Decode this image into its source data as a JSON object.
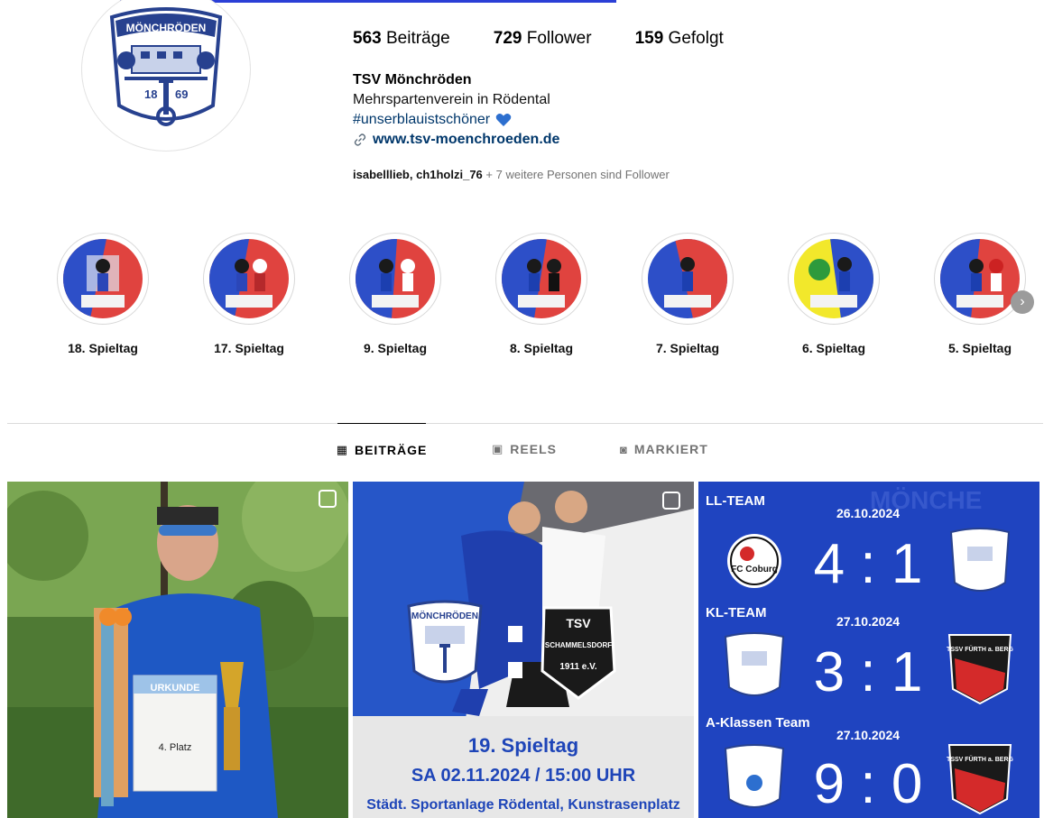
{
  "profile": {
    "posts_count": "563",
    "posts_label": "Beiträge",
    "followers_count": "729",
    "followers_label": "Follower",
    "following_count": "159",
    "following_label": "Gefolgt",
    "name": "TSV Mönchröden",
    "bio_line": "Mehrspartenverein in Rödental",
    "hashtag": "#unserblauistschöner",
    "website": "www.tsv-moenchroeden.de",
    "followed_by_names": "isabelllieb, ch1holzi_76",
    "followed_by_more": "+ 7 weitere Personen sind Follower",
    "logo_text": "MÖNCHRÖDEN",
    "logo_year_left": "18",
    "logo_year_right": "69"
  },
  "highlights": [
    {
      "label": "18. Spieltag"
    },
    {
      "label": "17. Spieltag"
    },
    {
      "label": "9. Spieltag"
    },
    {
      "label": "8. Spieltag"
    },
    {
      "label": "7. Spieltag"
    },
    {
      "label": "6. Spieltag"
    },
    {
      "label": "5. Spieltag"
    }
  ],
  "tabs": [
    {
      "label": "BEITRÄGE",
      "icon": "grid-icon"
    },
    {
      "label": "REELS",
      "icon": "reels-icon"
    },
    {
      "label": "MARKIERT",
      "icon": "tagged-icon"
    }
  ],
  "posts": {
    "post1": {
      "certificate_title": "URKUNDE",
      "certificate_place": "4. Platz"
    },
    "post2": {
      "club_left": "MÖNCHRÖDEN",
      "club_right_top": "TSV",
      "club_right_name": "SCHAMMELSDORF",
      "club_right_year": "1911 e.V.",
      "matchday": "19. Spieltag",
      "datetime": "SA 02.11.2024 / 15:00 UHR",
      "venue": "Städt. Sportanlage Rödental, Kunstrasenplatz"
    },
    "post3": {
      "rows": [
        {
          "team": "LL-TEAM",
          "date": "26.10.2024",
          "score": "4 : 1",
          "opponent": "FC Coburg"
        },
        {
          "team": "KL-TEAM",
          "date": "27.10.2024",
          "score": "3 : 1",
          "opponent": "TSSV FÜRTH a. BERG"
        },
        {
          "team": "A-Klassen Team",
          "date": "27.10.2024",
          "score": "9 : 0",
          "opponent": "TSSV FÜRTH a. BERG"
        }
      ],
      "watermark": "MÖNCHE"
    }
  }
}
